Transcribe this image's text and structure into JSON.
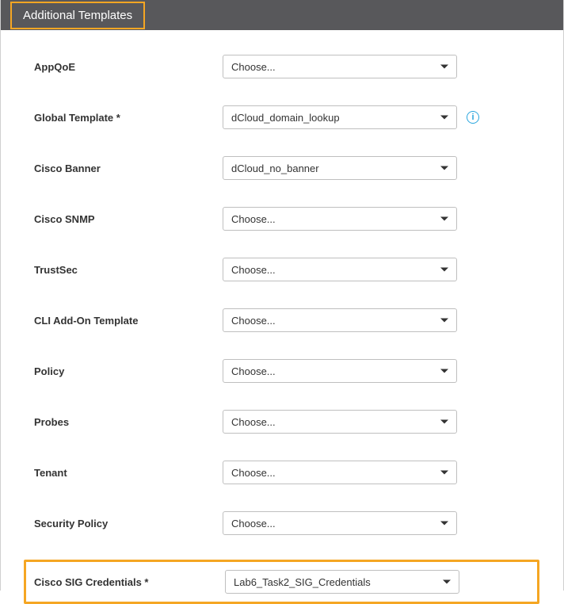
{
  "header": {
    "title": "Additional Templates"
  },
  "fields": {
    "appqoe": {
      "label": "AppQoE",
      "value": "Choose..."
    },
    "global_template": {
      "label": "Global Template *",
      "value": "dCloud_domain_lookup"
    },
    "cisco_banner": {
      "label": "Cisco Banner",
      "value": "dCloud_no_banner"
    },
    "cisco_snmp": {
      "label": "Cisco SNMP",
      "value": "Choose..."
    },
    "trustsec": {
      "label": "TrustSec",
      "value": "Choose..."
    },
    "cli_addon": {
      "label": "CLI Add-On Template",
      "value": "Choose..."
    },
    "policy": {
      "label": "Policy",
      "value": "Choose..."
    },
    "probes": {
      "label": "Probes",
      "value": "Choose..."
    },
    "tenant": {
      "label": "Tenant",
      "value": "Choose..."
    },
    "security_policy": {
      "label": "Security Policy",
      "value": "Choose..."
    },
    "sig_credentials": {
      "label": "Cisco SIG Credentials *",
      "value": "Lab6_Task2_SIG_Credentials"
    }
  },
  "info_glyph": "i"
}
